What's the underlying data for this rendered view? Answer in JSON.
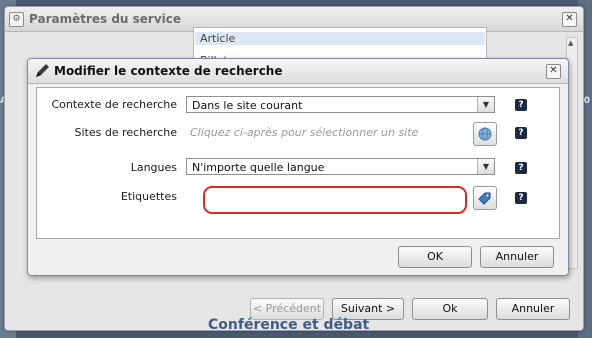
{
  "outer_dialog": {
    "title": "Paramètres du service",
    "list_items": [
      "Article",
      "Billet"
    ],
    "buttons": {
      "prev": "< Précédent",
      "next": "Suivant >",
      "ok": "Ok",
      "cancel": "Annuler"
    }
  },
  "inner_dialog": {
    "title": "Modifier le contexte de recherche",
    "fields": {
      "context": {
        "label": "Contexte de recherche",
        "value": "Dans le site courant"
      },
      "sites": {
        "label": "Sites de recherche",
        "placeholder": "Cliquez ci-après pour sélectionner un site"
      },
      "languages": {
        "label": "Langues",
        "value": "N'importe quelle langue"
      },
      "tags": {
        "label": "Etiquettes",
        "value": ""
      }
    },
    "help_glyph": "?",
    "buttons": {
      "ok": "OK",
      "cancel": "Annuler"
    }
  },
  "background": {
    "left_label": "Acc",
    "right_label": "0",
    "bottom_title": "Conférence et débat"
  },
  "colors": {
    "highlight": "#d62b2b",
    "help_bg": "#1b2a44"
  }
}
